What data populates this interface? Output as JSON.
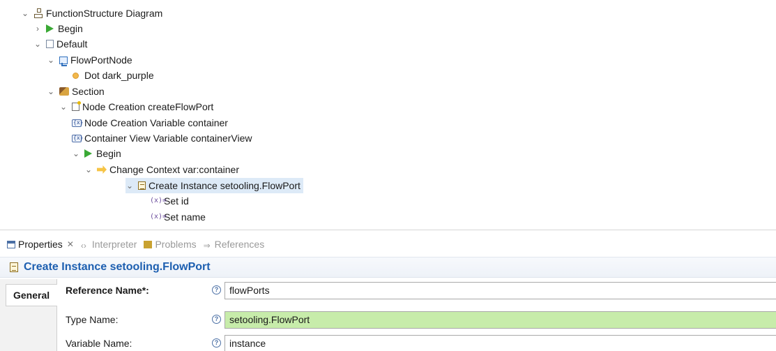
{
  "tree": {
    "nodes": [
      {
        "id": "n0",
        "label": "FunctionStructure Diagram",
        "twisty": "expanded",
        "icon": "structure-icon"
      },
      {
        "id": "n1",
        "label": "Begin",
        "twisty": "collapsed",
        "icon": "begin-play-icon"
      },
      {
        "id": "n2",
        "label": "Default",
        "twisty": "expanded",
        "icon": "page-icon"
      },
      {
        "id": "n3",
        "label": "FlowPortNode",
        "twisty": "expanded",
        "icon": "flowport-node-icon"
      },
      {
        "id": "n4",
        "label": "Dot dark_purple",
        "twisty": "none",
        "icon": "dot-icon"
      },
      {
        "id": "n5",
        "label": "Section",
        "twisty": "expanded",
        "icon": "section-icon"
      },
      {
        "id": "n6",
        "label": "Node Creation createFlowPort",
        "twisty": "expanded",
        "icon": "node-creation-icon"
      },
      {
        "id": "n7",
        "label": "Node Creation Variable container",
        "twisty": "none",
        "icon": "variable-icon"
      },
      {
        "id": "n8",
        "label": "Container View Variable containerView",
        "twisty": "none",
        "icon": "variable-icon"
      },
      {
        "id": "n9",
        "label": "Begin",
        "twisty": "expanded",
        "icon": "begin-play-icon"
      },
      {
        "id": "n10",
        "label": "Change Context var:container",
        "twisty": "expanded",
        "icon": "change-context-icon"
      },
      {
        "id": "n11",
        "label": "Create Instance setooling.FlowPort",
        "twisty": "expanded",
        "icon": "create-instance-icon",
        "selected": true
      },
      {
        "id": "n12",
        "label": "Set id",
        "twisty": "none",
        "icon": "set-value-icon"
      },
      {
        "id": "n13",
        "label": "Set name",
        "twisty": "none",
        "icon": "set-value-icon"
      }
    ]
  },
  "tabs": [
    {
      "label": "Properties",
      "active": true,
      "icon": "properties-icon"
    },
    {
      "label": "Interpreter",
      "active": false,
      "icon": "interpreter-icon"
    },
    {
      "label": "Problems",
      "active": false,
      "icon": "problems-icon"
    },
    {
      "label": "References",
      "active": false,
      "icon": "references-icon"
    }
  ],
  "properties": {
    "title": "Create Instance setooling.FlowPort",
    "section_tab": "General",
    "rows": [
      {
        "label": "Reference Name*:",
        "value": "flowPorts",
        "bold": true,
        "highlight": false
      },
      {
        "label": "Type Name:",
        "value": "setooling.FlowPort",
        "bold": false,
        "highlight": true
      },
      {
        "label": "Variable Name:",
        "value": "instance",
        "bold": false,
        "highlight": false
      }
    ]
  },
  "colors": {
    "selection_bg": "#ddeaf7",
    "title_blue": "#1d5fb0",
    "field_highlight": "#c7ecaa"
  }
}
